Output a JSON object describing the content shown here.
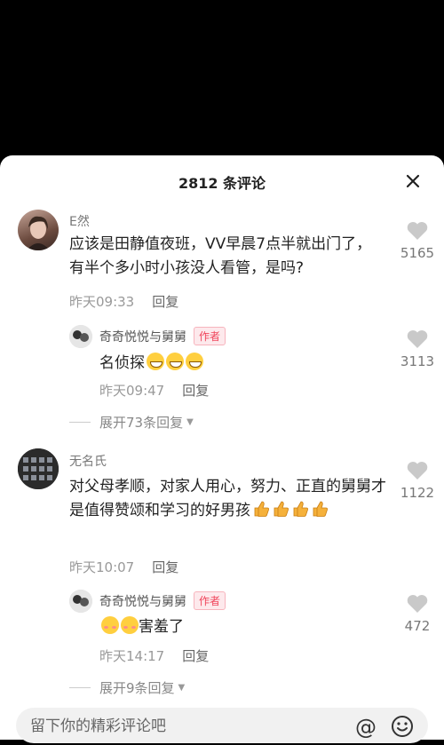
{
  "header": {
    "title": "2812 条评论"
  },
  "comments": [
    {
      "user": "E然",
      "text": "应该是田静值夜班，VV早晨7点半就出门了，有半个多小时小孩没人看管，是吗?",
      "time": "昨天09:33",
      "reply_label": "回复",
      "likes": "5165",
      "reply": {
        "user": "奇奇悦悦与舅舅",
        "badge": "作者",
        "text": "名侦探",
        "time": "昨天09:47",
        "reply_label": "回复",
        "likes": "3113"
      },
      "expand": "展开73条回复"
    },
    {
      "user": "无名氏",
      "text": "对父母孝顺，对家人用心，努力、正直的舅舅才是值得赞颂和学习的好男孩",
      "time": "昨天10:07",
      "reply_label": "回复",
      "likes": "1122",
      "reply": {
        "user": "奇奇悦悦与舅舅",
        "badge": "作者",
        "text": "害羞了",
        "time": "昨天14:17",
        "reply_label": "回复",
        "likes": "472"
      },
      "expand": "展开9条回复"
    }
  ],
  "input": {
    "placeholder": "留下你的精彩评论吧"
  },
  "icons": {
    "close": "close-icon",
    "like": "heart-icon",
    "at": "at-icon",
    "emoji": "emoji-icon"
  }
}
